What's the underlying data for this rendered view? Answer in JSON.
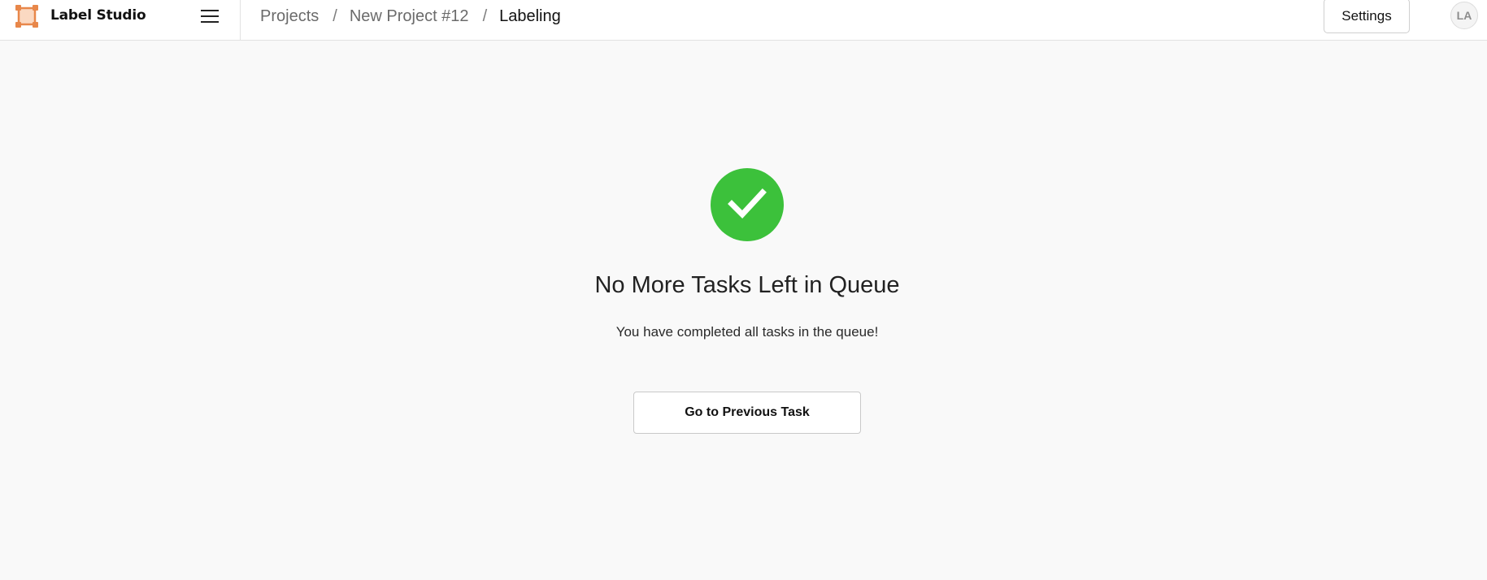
{
  "app": {
    "name": "Label Studio",
    "brand_color": "#e8874a"
  },
  "header": {
    "menu_icon": "hamburger-menu-icon",
    "breadcrumb": [
      "Projects",
      "New Project #12",
      "Labeling"
    ],
    "separator": "/",
    "settings_label": "Settings",
    "avatar_initials": "LA"
  },
  "main": {
    "status_icon": "check-circle-icon",
    "status_color": "#3cc13b",
    "title": "No More Tasks Left in Queue",
    "message": "You have completed all tasks in the queue!",
    "prev_button_label": "Go to Previous Task"
  }
}
